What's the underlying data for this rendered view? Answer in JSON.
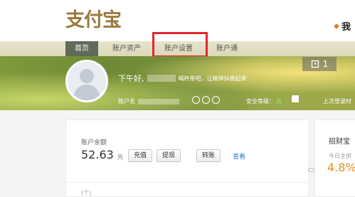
{
  "header": {
    "logo_text": "支付宝",
    "lang_label": "我"
  },
  "nav": {
    "items": [
      {
        "label": "首页"
      },
      {
        "label": "账户资产"
      },
      {
        "label": "账户设置"
      },
      {
        "label": "账户通"
      }
    ]
  },
  "banner": {
    "greeting": "下午好,",
    "greeting_tail": "喝杯茶吧，让精神抖擞起来",
    "account_label": "账户名",
    "security_label": "安全等级：",
    "security_value": "高",
    "last_login": "上次登录时",
    "alarm_count": "1"
  },
  "balance": {
    "label": "账户余额",
    "amount": "52.63",
    "unit": "元",
    "buttons": {
      "recharge": "充值",
      "withdraw": "提现",
      "transfer": "转账"
    },
    "view_link": "查看"
  },
  "zhaocai": {
    "title": "招财宝",
    "sub": "今日主供",
    "rate": "4.8%"
  },
  "bottom": {
    "text": "(ㄒ)"
  },
  "colors": {
    "accent_orange": "#f08a1c",
    "highlight_red": "#e3262e",
    "link_blue": "#2f7fcc"
  }
}
